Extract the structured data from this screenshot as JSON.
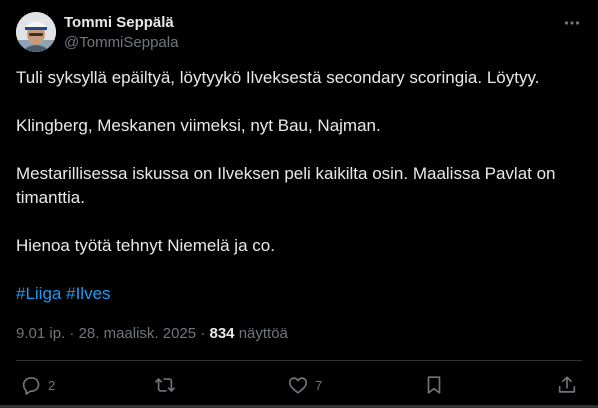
{
  "author": {
    "display_name": "Tommi Seppälä",
    "handle": "@TommiSeppala"
  },
  "tweet": {
    "paragraphs": [
      "Tuli syksyllä epäiltyä, löytyykö Ilveksestä secondary scoringia. Löytyy.",
      "Klingberg, Meskanen viimeksi, nyt Bau, Najman.",
      "Mestarillisessa iskussa on Ilveksen peli kaikilta osin. Maalissa Pavlat on timanttia.",
      "Hienoa työtä tehnyt Niemelä ja co."
    ],
    "hashtags": [
      "#Liiga",
      "#Ilves"
    ]
  },
  "meta": {
    "time": "9.01 ip.",
    "separator": "·",
    "date": "28. maalisk. 2025",
    "views_count": "834",
    "views_label": "näyttöä"
  },
  "actions": {
    "reply_count": "2",
    "like_count": "7"
  },
  "icons": {
    "more": "more-icon",
    "reply": "reply-icon",
    "retweet": "retweet-icon",
    "like": "like-icon",
    "bookmark": "bookmark-icon",
    "share": "share-icon"
  },
  "colors": {
    "background": "#000000",
    "text": "#e7e9ea",
    "secondary": "#71767b",
    "link": "#1d9bf0",
    "border": "#2f3336"
  }
}
